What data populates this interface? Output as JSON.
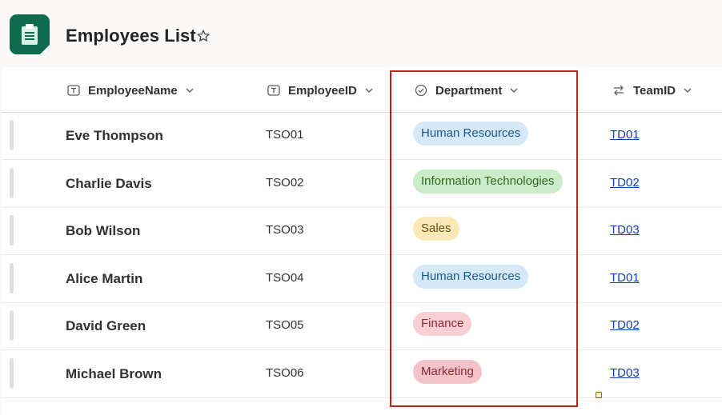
{
  "header": {
    "title": "Employees List",
    "app_icon": "clipboard-list-icon",
    "favorite_icon": "star-outline-icon"
  },
  "columns": [
    {
      "label": "EmployeeName",
      "icon": "text-field-icon"
    },
    {
      "label": "EmployeeID",
      "icon": "text-field-icon"
    },
    {
      "label": "Department",
      "icon": "choice-field-icon"
    },
    {
      "label": "TeamID",
      "icon": "lookup-field-icon"
    }
  ],
  "rows": [
    {
      "name": "Eve Thompson",
      "id": "TSO01",
      "department": "Human Resources",
      "team": "TD01"
    },
    {
      "name": "Charlie Davis",
      "id": "TSO02",
      "department": "Information Technologies",
      "team": "TD02"
    },
    {
      "name": "Bob Wilson",
      "id": "TSO03",
      "department": "Sales",
      "team": "TD03"
    },
    {
      "name": "Alice Martin",
      "id": "TSO04",
      "department": "Human Resources",
      "team": "TD01"
    },
    {
      "name": "David Green",
      "id": "TSO05",
      "department": "Finance",
      "team": "TD02"
    },
    {
      "name": "Michael Brown",
      "id": "TSO06",
      "department": "Marketing",
      "team": "TD03"
    }
  ],
  "department_colors": {
    "Human Resources": {
      "bg": "#d5e8f7",
      "fg": "#185a8f"
    },
    "Information Technologies": {
      "bg": "#caecc8",
      "fg": "#2e6b22"
    },
    "Sales": {
      "bg": "#fbe8b7",
      "fg": "#6b4f10"
    },
    "Finance": {
      "bg": "#f7cfd4",
      "fg": "#8a2a33"
    },
    "Marketing": {
      "bg": "#f3c3ca",
      "fg": "#8a2a33"
    }
  },
  "colors": {
    "brand": "#0e6b4d",
    "link": "#0f3fb8",
    "highlight_border": "#c81e1e"
  }
}
